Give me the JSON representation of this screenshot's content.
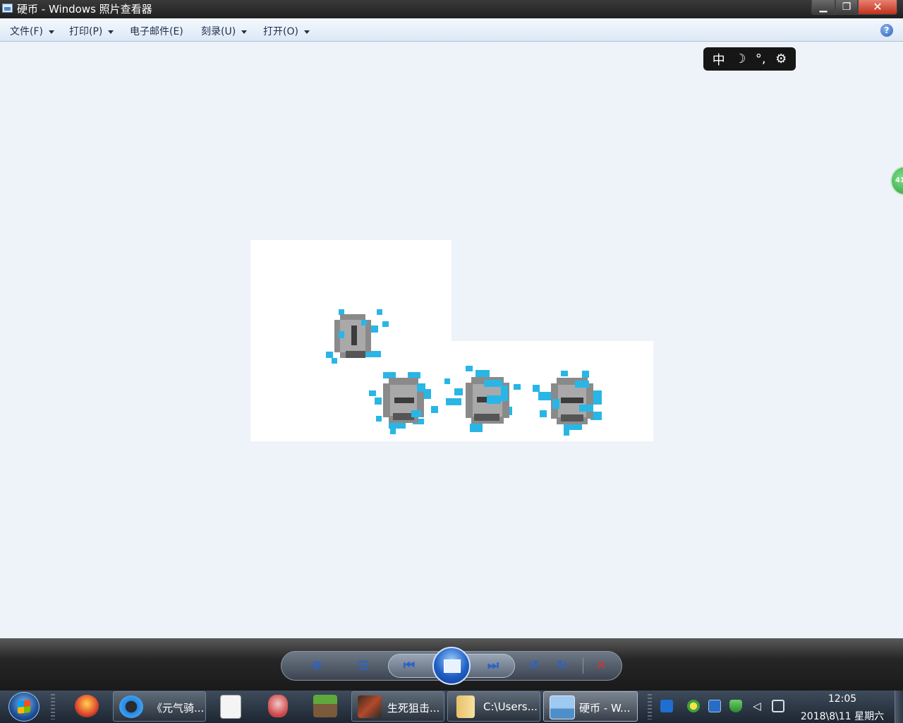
{
  "window": {
    "title": "硬币 - Windows 照片查看器",
    "min_glyph": "▁",
    "max_glyph": "❐",
    "close_glyph": "✕"
  },
  "menubar": {
    "items": [
      "文件(F)",
      "打印(P)",
      "电子邮件(E)",
      "刻录(U)",
      "打开(O)"
    ],
    "help_glyph": "?"
  },
  "ime": {
    "mode": "中",
    "moon_glyph": "☽",
    "punct_glyph": "°,",
    "gear_glyph": "⚙"
  },
  "side_bubble": {
    "text": "41"
  },
  "image": {
    "coin_gray": "#8a8a8a",
    "coin_dark": "#555555",
    "sparkle_blue": "#29b6e6"
  },
  "viewer_controls": {
    "zoom_glyph": "⊕",
    "fit_glyph": "⊡",
    "prev_glyph": "⏮",
    "next_glyph": "⏭",
    "rotate_left_glyph": "↺",
    "rotate_right_glyph": "↻",
    "delete_glyph": "✕"
  },
  "taskbar": {
    "buttons": [
      "《元气骑...",
      "生死狙击...",
      "C:\\Users...",
      "硬币 - W..."
    ],
    "clock": {
      "time": "12:05",
      "date": "2018\\8\\11 星期六"
    }
  }
}
